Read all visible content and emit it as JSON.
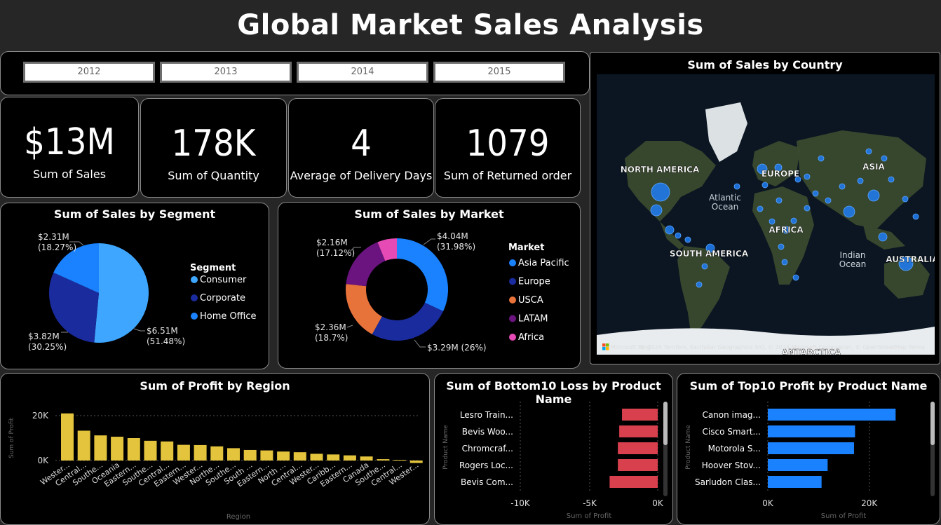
{
  "title": "Global Market Sales Analysis",
  "slicer": {
    "years": [
      "2012",
      "2013",
      "2014",
      "2015"
    ]
  },
  "kpis": [
    {
      "value": "$13M",
      "label": "Sum of Sales"
    },
    {
      "value": "178K",
      "label": "Sum of Quantity"
    },
    {
      "value": "4",
      "label": "Average of Delivery Days"
    },
    {
      "value": "1079",
      "label": "Sum of Returned order"
    }
  ],
  "map": {
    "title": "Sum of Sales by Country",
    "labels": [
      "NORTH AMERICA",
      "EUROPE",
      "ASIA",
      "Atlantic Ocean",
      "AFRICA",
      "SOUTH AMERICA",
      "Indian Ocean",
      "AUSTRALIA",
      "ANTARCTICA"
    ],
    "attribution": "© 2024 TomTom, Earthstar Geographics SIO, © 2024 Microsoft Corporation, © OpenStreetMap  Terms",
    "logo_text": "Microsoft Bing",
    "colors": {
      "bubble": "#1f7ef5",
      "ocean": "#0b1622",
      "land": "#3a4a2e",
      "ice": "#e8ecef"
    }
  },
  "chart_data": [
    {
      "type": "pie",
      "title": "Sum of Sales by Segment",
      "legend_title": "Segment",
      "legend_position": "right",
      "categories": [
        "Consumer",
        "Corporate",
        "Home Office"
      ],
      "values": [
        6.51,
        3.82,
        2.31
      ],
      "labels": [
        "$6.51M (51.48%)",
        "$3.82M (30.25%)",
        "$2.31M (18.27%)"
      ],
      "colors": [
        "#3ea6ff",
        "#1a2b9e",
        "#1a82ff"
      ]
    },
    {
      "type": "pie",
      "donut": true,
      "title": "Sum of Sales by Market",
      "legend_title": "Market",
      "legend_position": "right",
      "categories": [
        "Asia Pacific",
        "Europe",
        "USCA",
        "LATAM",
        "Africa"
      ],
      "values": [
        4.04,
        3.29,
        2.36,
        2.16,
        0.78
      ],
      "labels": [
        "$4.04M (31.98%)",
        "$3.29M (26%)",
        "$2.36M (18.7%)",
        "$2.16M (17.12%)",
        ""
      ],
      "colors": [
        "#1a82ff",
        "#1a2b9e",
        "#e8733a",
        "#6b1480",
        "#e64bb5"
      ]
    },
    {
      "type": "bar",
      "title": "Sum of Profit by Region",
      "xlabel": "Region",
      "ylabel": "Sum of Profit",
      "categories": [
        "Wester...",
        "Central...",
        "Southe...",
        "Oceania",
        "Eastern...",
        "Southe...",
        "Central...",
        "Eastern...",
        "Wester...",
        "Northe...",
        "Southe...",
        "South ...",
        "Eastern...",
        "North ...",
        "Central...",
        "Wester...",
        "Caribb...",
        "Eastern...",
        "Canada",
        "Southe...",
        "Central...",
        "Wester..."
      ],
      "values": [
        21000,
        13300,
        11200,
        10600,
        10000,
        8800,
        8500,
        7000,
        6900,
        6300,
        5500,
        4700,
        4500,
        4000,
        3700,
        3000,
        2700,
        2300,
        1800,
        600,
        300,
        -1100
      ],
      "yticks": [
        "0K",
        "20K"
      ],
      "ylim": [
        -2000,
        24000
      ],
      "color": "#e3c43c",
      "grid": true
    },
    {
      "type": "bar",
      "orientation": "horizontal",
      "title": "Sum of Bottom10 Loss by Product Name",
      "xlabel": "Sum of Profit",
      "ylabel": "Product Name",
      "categories": [
        "Lesro Train...",
        "Bevis Woo...",
        "Chromcraf...",
        "Rogers Loc...",
        "Bevis Com..."
      ],
      "values": [
        -2600,
        -2800,
        -2900,
        -2900,
        -3500
      ],
      "xticks": [
        "-10K",
        "-5K",
        "0K"
      ],
      "xlim": [
        -10000,
        0
      ],
      "color": "#d9404e"
    },
    {
      "type": "bar",
      "orientation": "horizontal",
      "title": "Sum of Top10 Profit by Product Name",
      "xlabel": "Sum of Profit",
      "ylabel": "Product Name",
      "categories": [
        "Canon imag...",
        "Cisco Smart...",
        "Motorola S...",
        "Hoover Stov...",
        "Sarludon Clas..."
      ],
      "values": [
        25200,
        17200,
        17000,
        11800,
        10600
      ],
      "xticks": [
        "0K",
        "20K"
      ],
      "xlim": [
        0,
        30000
      ],
      "color": "#1a82ff"
    }
  ]
}
